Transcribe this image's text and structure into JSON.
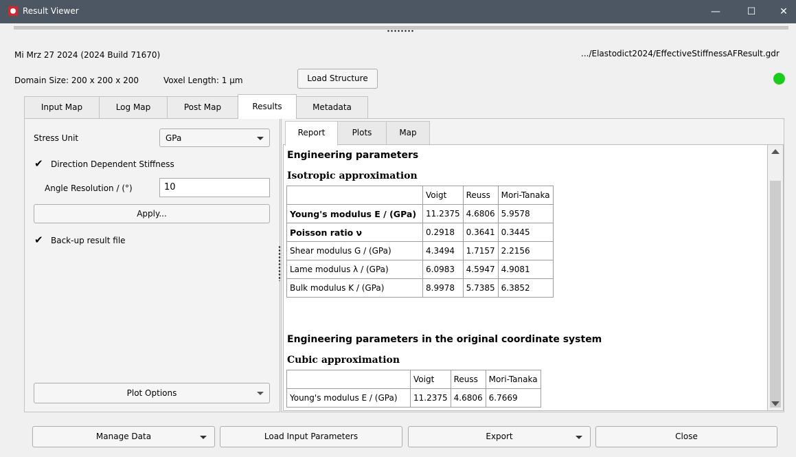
{
  "window": {
    "title": "Result Viewer",
    "minimize": "—",
    "maximize": "☐",
    "close": "✕"
  },
  "header": {
    "version": "Mi Mrz 27 2024 (2024 Build 71670)",
    "file_path": ".../Elastodict2024/EffectiveStiffnessAFResult.gdr",
    "domain_size": "Domain Size: 200 x 200 x 200",
    "voxel_length": "Voxel Length: 1 µm",
    "load_structure": "Load Structure",
    "status_color": "#1ccc1c"
  },
  "tabs": [
    "Input Map",
    "Log Map",
    "Post Map",
    "Results",
    "Metadata"
  ],
  "active_tab": "Results",
  "left": {
    "stress_unit_label": "Stress Unit",
    "stress_unit_value": "GPa",
    "direction_dependent": "Direction Dependent Stiffness",
    "angle_resolution_label": "Angle Resolution / (°)",
    "angle_resolution_value": "10",
    "apply": "Apply...",
    "backup": "Back-up result file",
    "plot_options": "Plot Options"
  },
  "inner_tabs": [
    "Report",
    "Plots",
    "Map"
  ],
  "report": {
    "heading1": "Engineering parameters",
    "iso_heading": "Isotropic approximation",
    "iso_columns": [
      "",
      "Voigt",
      "Reuss",
      "Mori-Tanaka"
    ],
    "iso_rows": [
      [
        "Young's modulus E / (GPa)",
        "11.2375",
        "4.6806",
        "5.9578"
      ],
      [
        "Poisson ratio ν",
        "0.2918",
        "0.3641",
        "0.3445"
      ],
      [
        "Shear modulus G / (GPa)",
        "4.3494",
        "1.7157",
        "2.2156"
      ],
      [
        "Lame modulus λ / (GPa)",
        "6.0983",
        "4.5947",
        "4.9081"
      ],
      [
        "Bulk modulus K / (GPa)",
        "8.9978",
        "5.7385",
        "6.3852"
      ]
    ],
    "heading2": "Engineering parameters in the original coordinate system",
    "cubic_heading": "Cubic approximation",
    "cubic_columns": [
      "",
      "Voigt",
      "Reuss",
      "Mori-Tanaka"
    ],
    "cubic_rows": [
      [
        "Young's modulus E / (GPa)",
        "11.2375",
        "4.6806",
        "6.7669"
      ]
    ]
  },
  "bottom": {
    "manage_data": "Manage Data",
    "load_input": "Load Input Parameters",
    "export": "Export",
    "close": "Close"
  }
}
